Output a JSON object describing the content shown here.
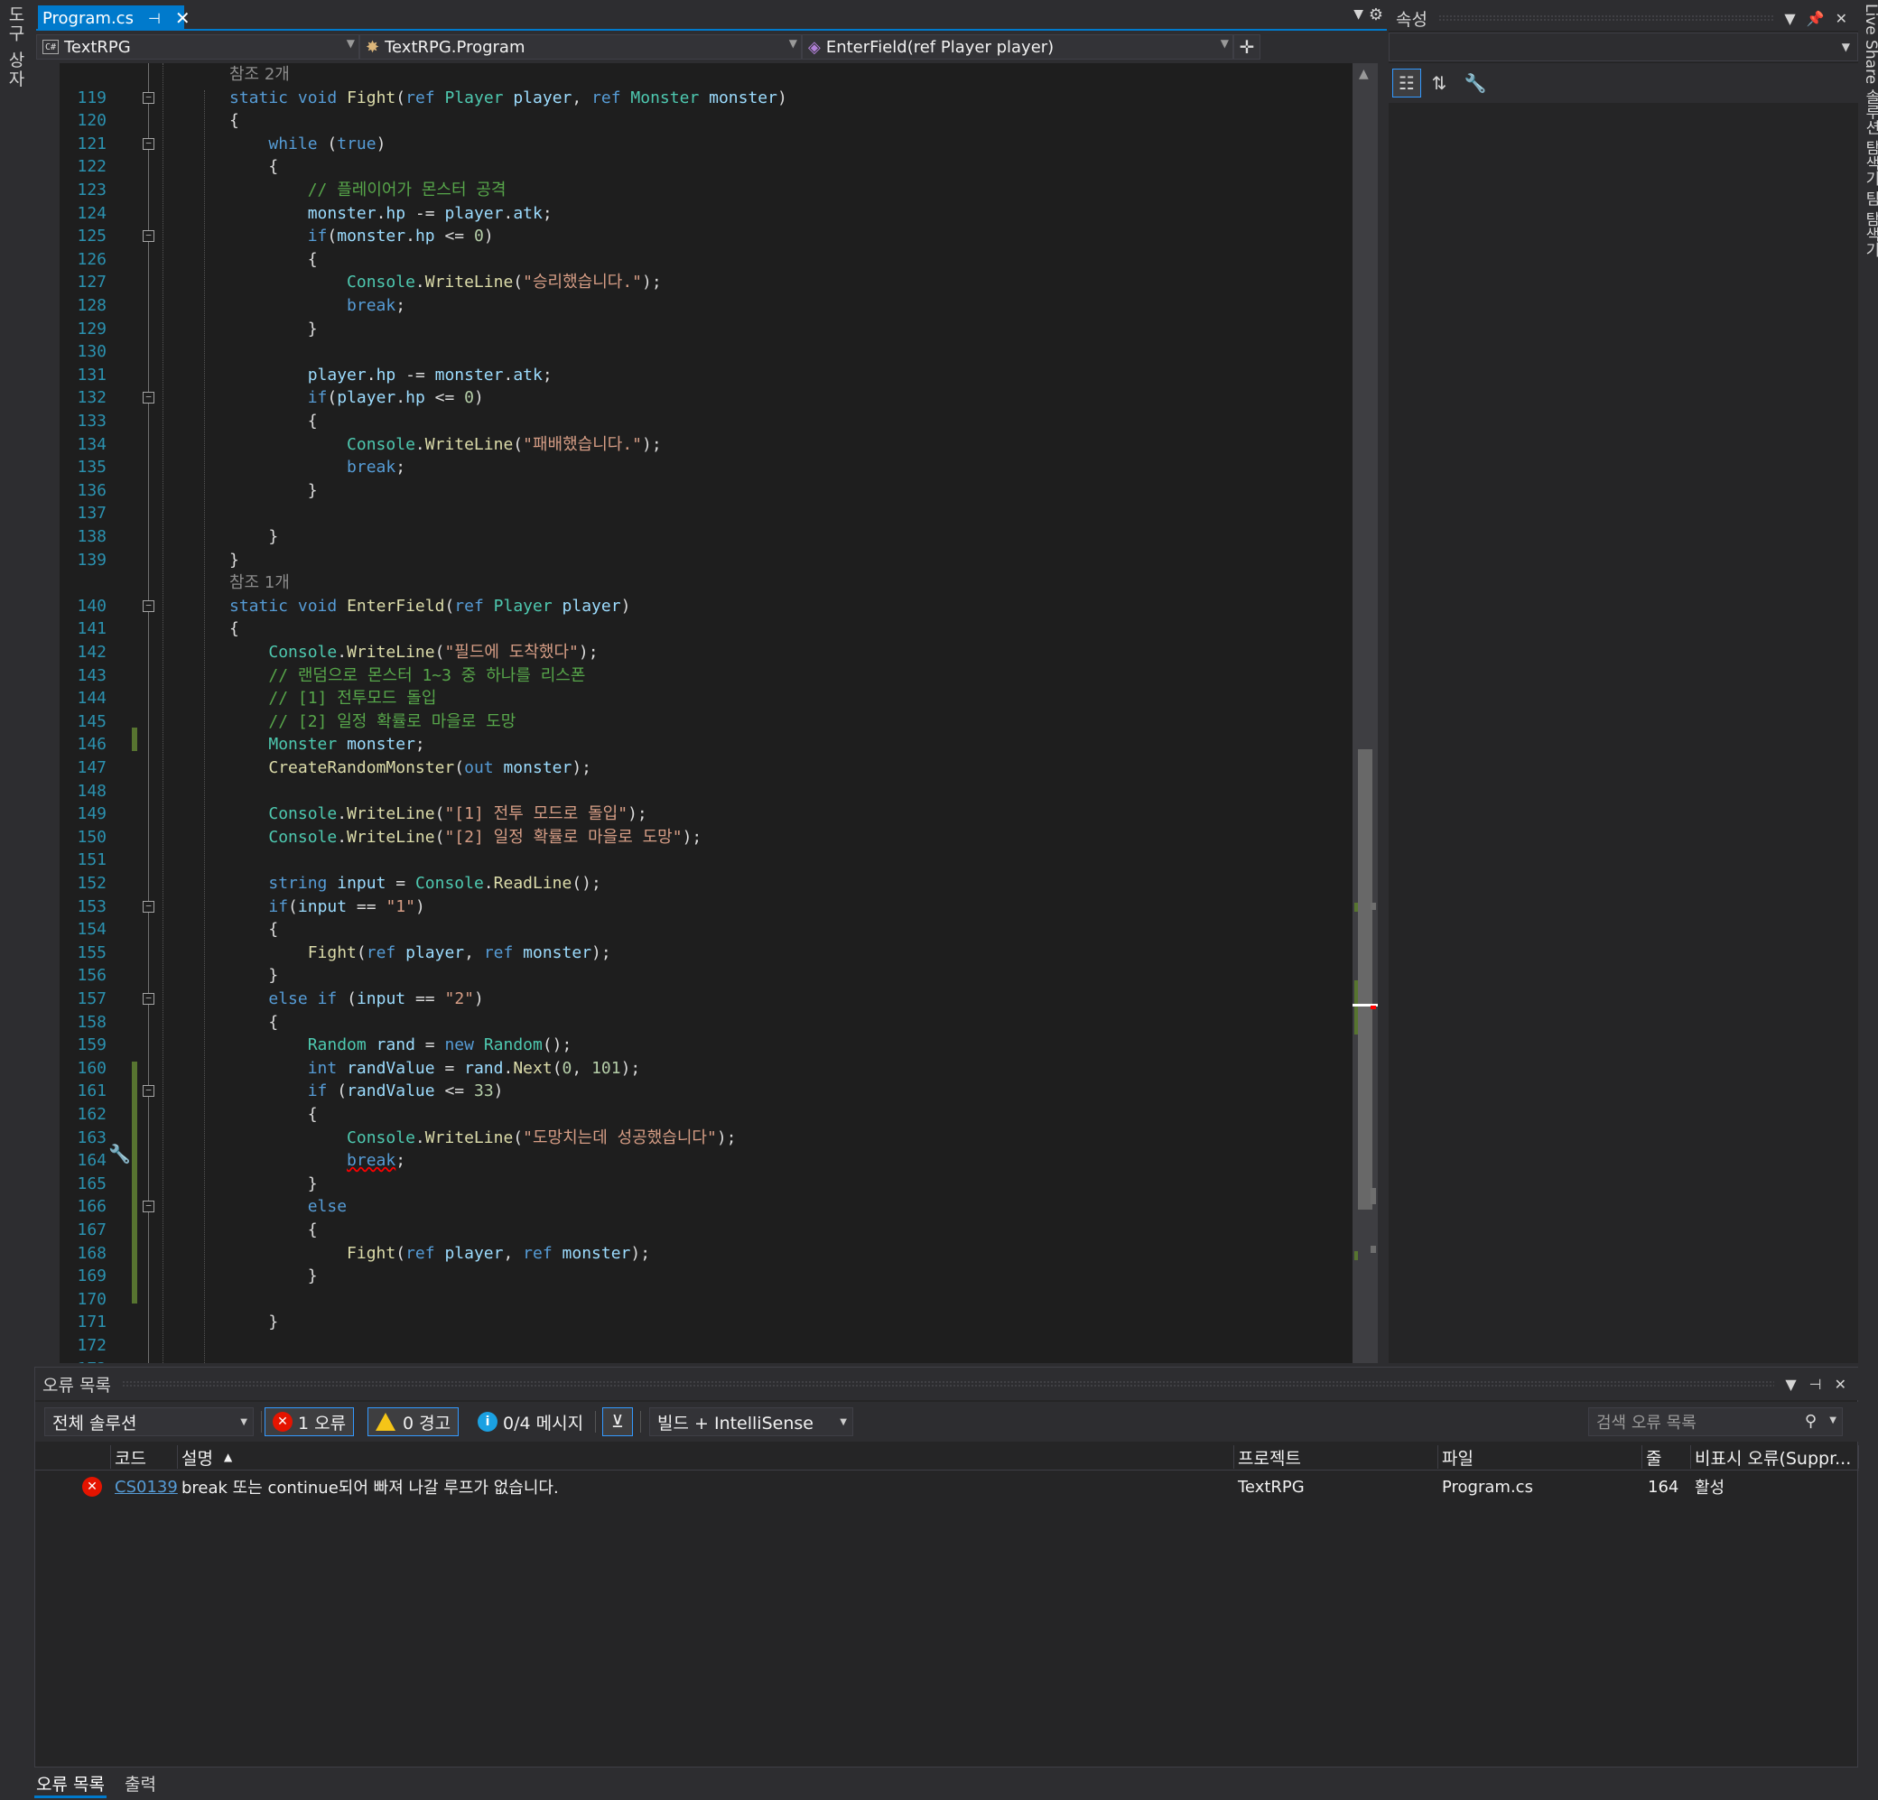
{
  "left_strip": {
    "label": "도구 상자"
  },
  "right_strip": {
    "label": "Live Share 솔루션 탐색기 팀 탐색기"
  },
  "tab": {
    "label": "Program.cs",
    "pin": "⊣",
    "close": "✕"
  },
  "navbar": {
    "project": "TextRPG",
    "type": "TextRPG.Program",
    "member": "EnterField(ref Player player)"
  },
  "editor": {
    "lines": [
      {
        "ref": "참조 2개"
      },
      {
        "n": "119",
        "fold": true,
        "html": "<span class=\"k\">static</span> <span class=\"k\">void</span> <span class=\"m\">Fight</span>(<span class=\"k\">ref</span> <span class=\"t\">Player</span> <span class=\"v\">player</span>, <span class=\"k\">ref</span> <span class=\"t\">Monster</span> <span class=\"v\">monster</span>)"
      },
      {
        "n": "120",
        "html": "{"
      },
      {
        "n": "121",
        "fold": true,
        "html": "    <span class=\"k\">while</span> (<span class=\"k\">true</span>)"
      },
      {
        "n": "122",
        "html": "    {"
      },
      {
        "n": "123",
        "html": "        <span class=\"c\">// 플레이어가 몬스터 공격</span>"
      },
      {
        "n": "124",
        "html": "        <span class=\"v\">monster</span>.<span class=\"v\">hp</span> -= <span class=\"v\">player</span>.<span class=\"v\">atk</span>;"
      },
      {
        "n": "125",
        "fold": true,
        "html": "        <span class=\"k\">if</span>(<span class=\"v\">monster</span>.<span class=\"v\">hp</span> &lt;= <span class=\"n\">0</span>)"
      },
      {
        "n": "126",
        "html": "        {"
      },
      {
        "n": "127",
        "html": "            <span class=\"t\">Console</span>.<span class=\"m\">WriteLine</span>(<span class=\"s\">\"승리했습니다.\"</span>);"
      },
      {
        "n": "128",
        "html": "            <span class=\"k\">break</span>;"
      },
      {
        "n": "129",
        "html": "        }"
      },
      {
        "n": "130",
        "html": ""
      },
      {
        "n": "131",
        "html": "        <span class=\"v\">player</span>.<span class=\"v\">hp</span> -= <span class=\"v\">monster</span>.<span class=\"v\">atk</span>;"
      },
      {
        "n": "132",
        "fold": true,
        "html": "        <span class=\"k\">if</span>(<span class=\"v\">player</span>.<span class=\"v\">hp</span> &lt;= <span class=\"n\">0</span>)"
      },
      {
        "n": "133",
        "html": "        {"
      },
      {
        "n": "134",
        "html": "            <span class=\"t\">Console</span>.<span class=\"m\">WriteLine</span>(<span class=\"s\">\"패배했습니다.\"</span>);"
      },
      {
        "n": "135",
        "html": "            <span class=\"k\">break</span>;"
      },
      {
        "n": "136",
        "html": "        }"
      },
      {
        "n": "137",
        "html": ""
      },
      {
        "n": "138",
        "html": "    }"
      },
      {
        "n": "139",
        "html": "}"
      },
      {
        "ref": "참조 1개"
      },
      {
        "n": "140",
        "fold": true,
        "html": "<span class=\"k\">static</span> <span class=\"k\">void</span> <span class=\"m\">EnterField</span>(<span class=\"k\">ref</span> <span class=\"t\">Player</span> <span class=\"v\">player</span>)"
      },
      {
        "n": "141",
        "html": "{"
      },
      {
        "n": "142",
        "html": "    <span class=\"t\">Console</span>.<span class=\"m\">WriteLine</span>(<span class=\"s\">\"필드에 도착했다\"</span>);"
      },
      {
        "n": "143",
        "html": "    <span class=\"c\">// 랜덤으로 몬스터 1~3 중 하나를 리스폰</span>"
      },
      {
        "n": "144",
        "html": "    <span class=\"c\">// [1] 전투모드 돌입</span>"
      },
      {
        "n": "145",
        "html": "    <span class=\"c\">// [2] 일정 확률로 마을로 도망</span>"
      },
      {
        "n": "146",
        "html": "    <span class=\"t\">Monster</span> <span class=\"v\">monster</span>;"
      },
      {
        "n": "147",
        "html": "    <span class=\"m\">CreateRandomMonster</span>(<span class=\"k\">out</span> <span class=\"v\">monster</span>);"
      },
      {
        "n": "148",
        "html": ""
      },
      {
        "n": "149",
        "html": "    <span class=\"t\">Console</span>.<span class=\"m\">WriteLine</span>(<span class=\"s\">\"[1] 전투 모드로 돌입\"</span>);"
      },
      {
        "n": "150",
        "html": "    <span class=\"t\">Console</span>.<span class=\"m\">WriteLine</span>(<span class=\"s\">\"[2] 일정 확률로 마을로 도망\"</span>);"
      },
      {
        "n": "151",
        "html": ""
      },
      {
        "n": "152",
        "html": "    <span class=\"k\">string</span> <span class=\"v\">input</span> = <span class=\"t\">Console</span>.<span class=\"m\">ReadLine</span>();"
      },
      {
        "n": "153",
        "fold": true,
        "html": "    <span class=\"k\">if</span>(<span class=\"v\">input</span> == <span class=\"s\">\"1\"</span>)"
      },
      {
        "n": "154",
        "html": "    {"
      },
      {
        "n": "155",
        "html": "        <span class=\"m\">Fight</span>(<span class=\"k\">ref</span> <span class=\"v\">player</span>, <span class=\"k\">ref</span> <span class=\"v\">monster</span>);"
      },
      {
        "n": "156",
        "html": "    }"
      },
      {
        "n": "157",
        "fold": true,
        "html": "    <span class=\"k\">else</span> <span class=\"k\">if</span> (<span class=\"v\">input</span> == <span class=\"s\">\"2\"</span>)"
      },
      {
        "n": "158",
        "html": "    {"
      },
      {
        "n": "159",
        "html": "        <span class=\"t\">Random</span> <span class=\"v\">rand</span> = <span class=\"k\">new</span> <span class=\"t\">Random</span>();"
      },
      {
        "n": "160",
        "html": "        <span class=\"k\">int</span> <span class=\"v\">randValue</span> = <span class=\"v\">rand</span>.<span class=\"m\">Next</span>(<span class=\"n\">0</span>, <span class=\"n\">101</span>);"
      },
      {
        "n": "161",
        "fold": true,
        "html": "        <span class=\"k\">if</span> (<span class=\"v\">randValue</span> &lt;= <span class=\"n\">33</span>)"
      },
      {
        "n": "162",
        "html": "        {"
      },
      {
        "n": "163",
        "html": "            <span class=\"t\">Console</span>.<span class=\"m\">WriteLine</span>(<span class=\"s\">\"도망치는데 성공했습니다\"</span>);"
      },
      {
        "n": "164",
        "html": "            <span class=\"k err\">break</span>;"
      },
      {
        "n": "165",
        "html": "        }"
      },
      {
        "n": "166",
        "fold": true,
        "html": "        <span class=\"k\">else</span>"
      },
      {
        "n": "167",
        "html": "        {"
      },
      {
        "n": "168",
        "html": "            <span class=\"m\">Fight</span>(<span class=\"k\">ref</span> <span class=\"v\">player</span>, <span class=\"k\">ref</span> <span class=\"v\">monster</span>);"
      },
      {
        "n": "169",
        "html": "        }"
      },
      {
        "n": "170",
        "html": ""
      },
      {
        "n": "171",
        "html": "    }"
      },
      {
        "n": "172",
        "html": ""
      },
      {
        "n": "173",
        "html": ""
      }
    ]
  },
  "properties": {
    "title": "속성"
  },
  "error_list": {
    "title": "오류 목록",
    "scope": "전체 솔루션",
    "errors": "1 오류",
    "warnings": "0 경고",
    "messages": "0/4 메시지",
    "build_filter": "빌드 + IntelliSense",
    "search_placeholder": "검색 오류 목록",
    "headers": {
      "code": "코드",
      "description": "설명",
      "project": "프로젝트",
      "file": "파일",
      "line": "줄",
      "suppression": "비표시 오류(Suppr..."
    },
    "rows": [
      {
        "code": "CS0139",
        "description": "break 또는 continue되어 빠져 나갈 루프가 없습니다.",
        "project": "TextRPG",
        "file": "Program.cs",
        "line": "164",
        "suppression": "활성"
      }
    ]
  },
  "bottom_tabs": [
    "오류 목록",
    "출력"
  ]
}
